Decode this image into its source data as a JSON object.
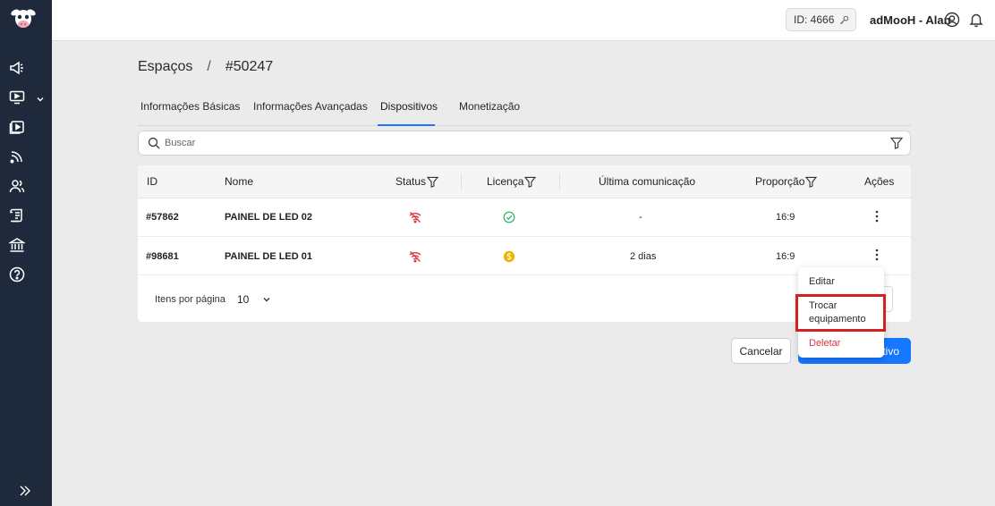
{
  "header": {
    "id_label": "ID: 4666",
    "user_name": "adMooH - Alan"
  },
  "sidebar": {
    "items": [
      {
        "icon": "megaphone-icon"
      },
      {
        "icon": "screen-icon"
      },
      {
        "icon": "play-media-icon"
      },
      {
        "icon": "feed-icon"
      },
      {
        "icon": "users-icon"
      },
      {
        "icon": "document-icon"
      },
      {
        "icon": "bank-icon"
      },
      {
        "icon": "help-icon"
      }
    ]
  },
  "breadcrumb": {
    "root": "Espaços",
    "separator": "/",
    "current": "#50247"
  },
  "tabs": [
    {
      "label": "Informações Básicas"
    },
    {
      "label": "Informações Avançadas"
    },
    {
      "label": "Dispositivos",
      "active": true
    },
    {
      "label": "Monetização"
    }
  ],
  "search": {
    "placeholder": "Buscar"
  },
  "table": {
    "columns": [
      "ID",
      "Nome",
      "Status",
      "Licença",
      "Última comunicação",
      "Proporção",
      "Ações"
    ],
    "rows": [
      {
        "id": "#57862",
        "name": "PAINEL DE LED 02",
        "status": "offline",
        "license": "valid",
        "last_comm": "-",
        "ratio": "16:9"
      },
      {
        "id": "#98681",
        "name": "PAINEL DE LED 01",
        "status": "offline",
        "license": "paid",
        "last_comm": "2 dias",
        "ratio": "16:9"
      }
    ],
    "pagination": {
      "label": "Itens por página",
      "value": "10"
    }
  },
  "actions": {
    "cancel": "Cancelar",
    "primary": "tivo"
  },
  "menu": {
    "items": [
      "Editar",
      "Trocar equipamento",
      "Deletar"
    ]
  },
  "colors": {
    "sidebar": "#1e2a3b",
    "accent": "#1677ff",
    "danger": "#d9363e",
    "success": "#22b35e",
    "warning": "#f0b400",
    "highlight": "#d32020"
  }
}
